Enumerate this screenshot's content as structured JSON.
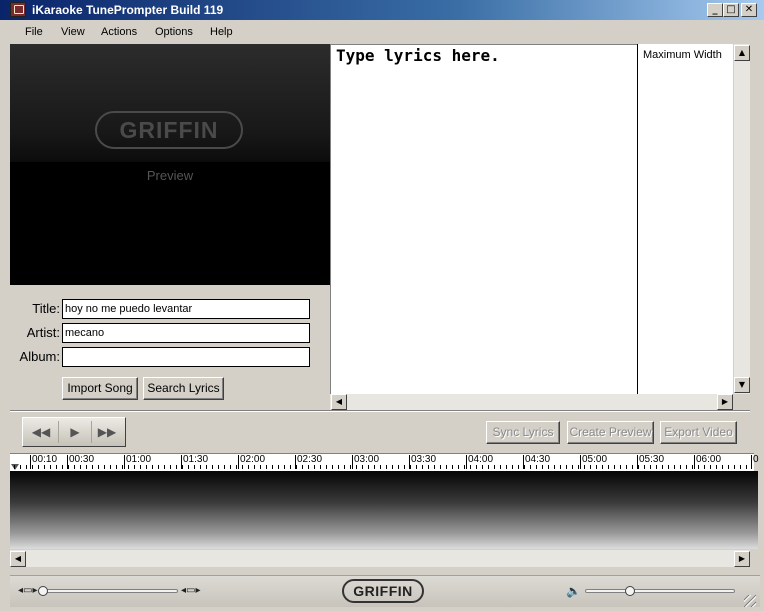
{
  "window": {
    "title": "iKaraoke TunePrompter Build 119",
    "minimize": "_",
    "maximize": "□",
    "close": "✕"
  },
  "menu": {
    "items": [
      "File",
      "View",
      "Actions",
      "Options",
      "Help"
    ]
  },
  "preview": {
    "logo": "GRIFFIN",
    "label": "Preview"
  },
  "form": {
    "title_label": "Title:",
    "title_value": "hoy no me puedo levantar",
    "artist_label": "Artist:",
    "artist_value": "mecano",
    "album_label": "Album:",
    "album_value": ""
  },
  "buttons": {
    "import_song": "Import Song",
    "search_lyrics": "Search Lyrics",
    "sync_lyrics": "Sync Lyrics",
    "create_preview": "Create Preview",
    "export_video": "Export Video"
  },
  "lyrics": {
    "placeholder": "Type lyrics here.",
    "max_width_label": "Maximum Width"
  },
  "transport": {
    "rewind": "◀◀",
    "play": "▶",
    "forward": "▶▶"
  },
  "timeline": {
    "ticks": [
      "00:10",
      "00:30",
      "01:00",
      "01:30",
      "02:00",
      "02:30",
      "03:00",
      "03:30",
      "04:00",
      "04:30",
      "05:00",
      "05:30",
      "06:00",
      "0"
    ]
  },
  "footer": {
    "logo": "GRIFFIN",
    "zoom_out_icon": "◂▭▸",
    "zoom_in_icon": "◂▭▸",
    "volume_icon": "🔈",
    "zoom_level": 0.02,
    "volume_level": 0.3
  }
}
